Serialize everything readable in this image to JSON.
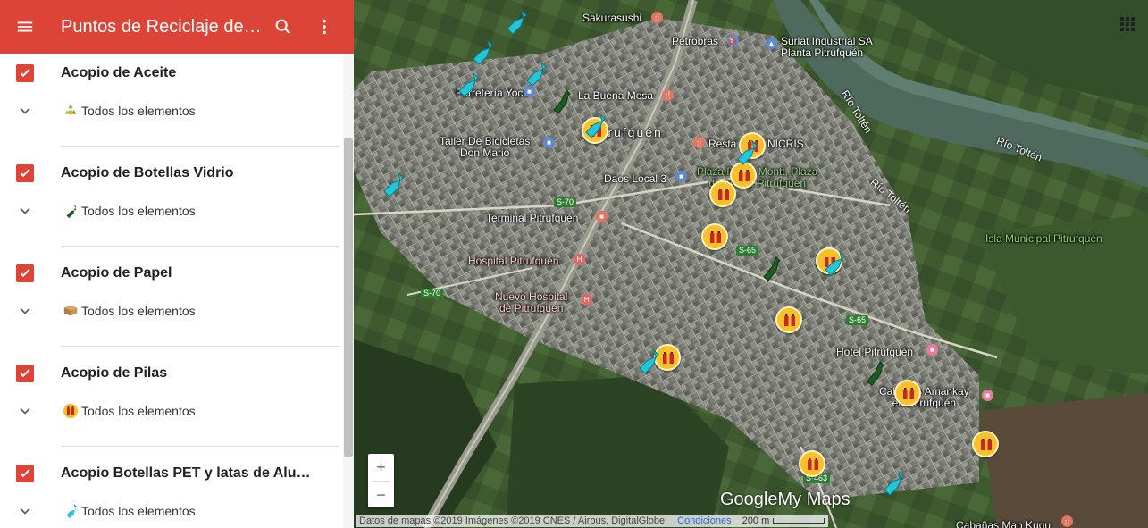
{
  "header": {
    "title": "Puntos de Reciclaje de Pitrufquén",
    "menu_icon": "menu-icon",
    "search_icon": "search-icon",
    "more_icon": "more-vert-icon",
    "color": "#db4437"
  },
  "layers": [
    {
      "name": "Acopio de Aceite",
      "sub_label": "Todos los elementos",
      "icon": "oil-recycle-icon",
      "checked": true
    },
    {
      "name": "Acopio de Botellas Vidrio",
      "sub_label": "Todos los elementos",
      "icon": "glass-bottle-icon",
      "checked": true
    },
    {
      "name": "Acopio de Papel",
      "sub_label": "Todos los elementos",
      "icon": "paper-box-icon",
      "checked": true
    },
    {
      "name": "Acopio de Pilas",
      "sub_label": "Todos los elementos",
      "icon": "battery-icon",
      "checked": true
    },
    {
      "name": "Acopio Botellas PET y latas de Aluminio",
      "sub_label": "Todos los elementos",
      "icon": "pet-bottle-icon",
      "checked": true
    }
  ],
  "map": {
    "labels": {
      "sakurasushi": "Sakurasushi",
      "petrobras": "Petrobras",
      "surlat": "Surlat Industrial SA\nPlanta Pitrufquén",
      "ferreteria": "Ferretería Yoce",
      "labuenamesa": "La Buena Mesa",
      "pitrufquen": "Pitrufquén",
      "taller": "Taller De Bicicletas\nDon Mario",
      "resta": "Resta",
      "nicris": "NICRIS",
      "plaza": "Plaza Pedro Montt, Plaza\nde Armas Pitrufquén",
      "daos": "Daos Local 3",
      "terminal": "Terminal Pitrufquén",
      "hospital": "Hospital Pitrufquén",
      "nuevohospital": "Nuevo Hospital\nde Pitrufquén",
      "isla": "Isla Municipal Pitrufquén",
      "hotel": "Hotel Pitrufquén",
      "amankay": "Cabañas Amankay\nen Pitrufquén",
      "cabanas": "Cabañas Man Kugu",
      "rio1": "Río Toltén",
      "rio2": "Río Toltén",
      "rio3": "Río Toltén"
    },
    "roads": {
      "s70a": "S-70",
      "s70b": "S-70",
      "s65a": "S-65",
      "s65b": "S-65",
      "s463": "S-463"
    },
    "zoom_in": "+",
    "zoom_out": "−",
    "logo_google": "Google",
    "logo_mymaps": "My Maps",
    "attribution": "Datos de mapas ©2019 Imágenes ©2019 CNES / Airbus, DigitalGlobe",
    "conditions": "Condiciones",
    "scale": "200 m"
  }
}
